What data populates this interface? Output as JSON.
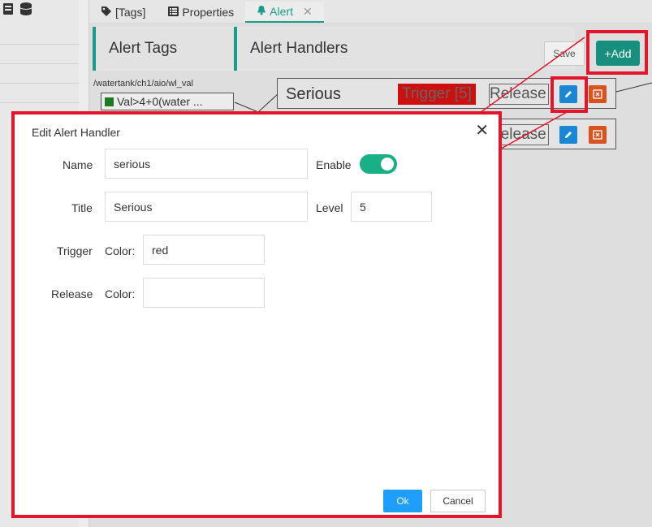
{
  "tabs": [
    {
      "label": "[Tags]",
      "icon": "tags-icon",
      "active": false
    },
    {
      "label": "Properties",
      "icon": "list-icon",
      "active": false
    },
    {
      "label": "Alert",
      "icon": "bell-icon",
      "active": true,
      "closable": true
    }
  ],
  "panel": {
    "alert_tags_heading": "Alert Tags",
    "alert_handlers_heading": "Alert Handlers",
    "save_label": "Save",
    "add_label": "+Add",
    "tag_path": "/watertank/ch1/aio/wl_val",
    "tag_node_label": "Val>4+0(water ...",
    "handlers": [
      {
        "title": "Serious",
        "trigger_label": "Trigger [5]",
        "release_label": "Release"
      },
      {
        "title": "",
        "trigger_label": "",
        "release_label": "Release"
      }
    ]
  },
  "dialog": {
    "title": "Edit Alert Handler",
    "name_label": "Name",
    "name_value": "serious",
    "enable_label": "Enable",
    "enable_on": true,
    "title_label": "Title",
    "title_value": "Serious",
    "level_label": "Level",
    "level_value": "5",
    "trigger_label": "Trigger",
    "trigger_color_label": "Color:",
    "trigger_color_value": "red",
    "release_label": "Release",
    "release_color_label": "Color:",
    "release_color_value": "",
    "ok_label": "Ok",
    "cancel_label": "Cancel"
  },
  "colors": {
    "accent": "#1a9c8a",
    "add_button": "#168f7e",
    "highlight": "#e3152b",
    "ok_button": "#1e9fff",
    "toggle_on": "#1ab086",
    "trigger_bg": "#cc1010"
  }
}
